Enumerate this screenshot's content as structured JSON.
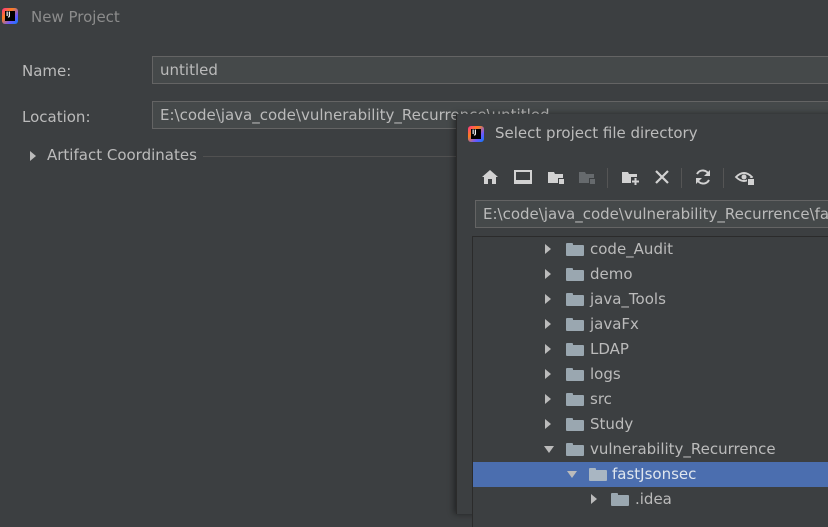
{
  "window": {
    "title": "New Project",
    "logo_text": "IJ"
  },
  "form": {
    "name_label": "Name:",
    "name_value": "untitled",
    "location_label": "Location:",
    "location_value": "E:\\code\\java_code\\vulnerability_Recurrence\\untitled",
    "artifact_label": "Artifact Coordinates"
  },
  "dialog": {
    "title": "Select project file directory",
    "logo_text": "IJ",
    "toolbar": [
      {
        "icon": "home-icon"
      },
      {
        "icon": "desktop-icon"
      },
      {
        "icon": "project-folder-icon"
      },
      {
        "icon": "module-folder-icon"
      },
      {
        "icon": "new-folder-icon"
      },
      {
        "icon": "delete-icon"
      },
      {
        "icon": "refresh-icon"
      },
      {
        "icon": "show-hidden-icon"
      }
    ],
    "path_value": "E:\\code\\java_code\\vulnerability_Recurrence\\fastJsonsec",
    "tree": [
      {
        "label": "code_Audit",
        "expanded": false,
        "selected": false
      },
      {
        "label": "demo",
        "expanded": false,
        "selected": false
      },
      {
        "label": "java_Tools",
        "expanded": false,
        "selected": false
      },
      {
        "label": "javaFx",
        "expanded": false,
        "selected": false
      },
      {
        "label": "LDAP",
        "expanded": false,
        "selected": false
      },
      {
        "label": "logs",
        "expanded": false,
        "selected": false
      },
      {
        "label": "src",
        "expanded": false,
        "selected": false
      },
      {
        "label": "Study",
        "expanded": false,
        "selected": false
      },
      {
        "label": "vulnerability_Recurrence",
        "expanded": true,
        "selected": false
      },
      {
        "label": "fastJsonsec",
        "expanded": true,
        "selected": true
      },
      {
        "label": ".idea",
        "expanded": false,
        "selected": false
      }
    ]
  },
  "colors": {
    "background": "#3c3f41",
    "selection": "#4b6eaf",
    "text": "#bbbbbb",
    "input_bg": "#45494a"
  }
}
